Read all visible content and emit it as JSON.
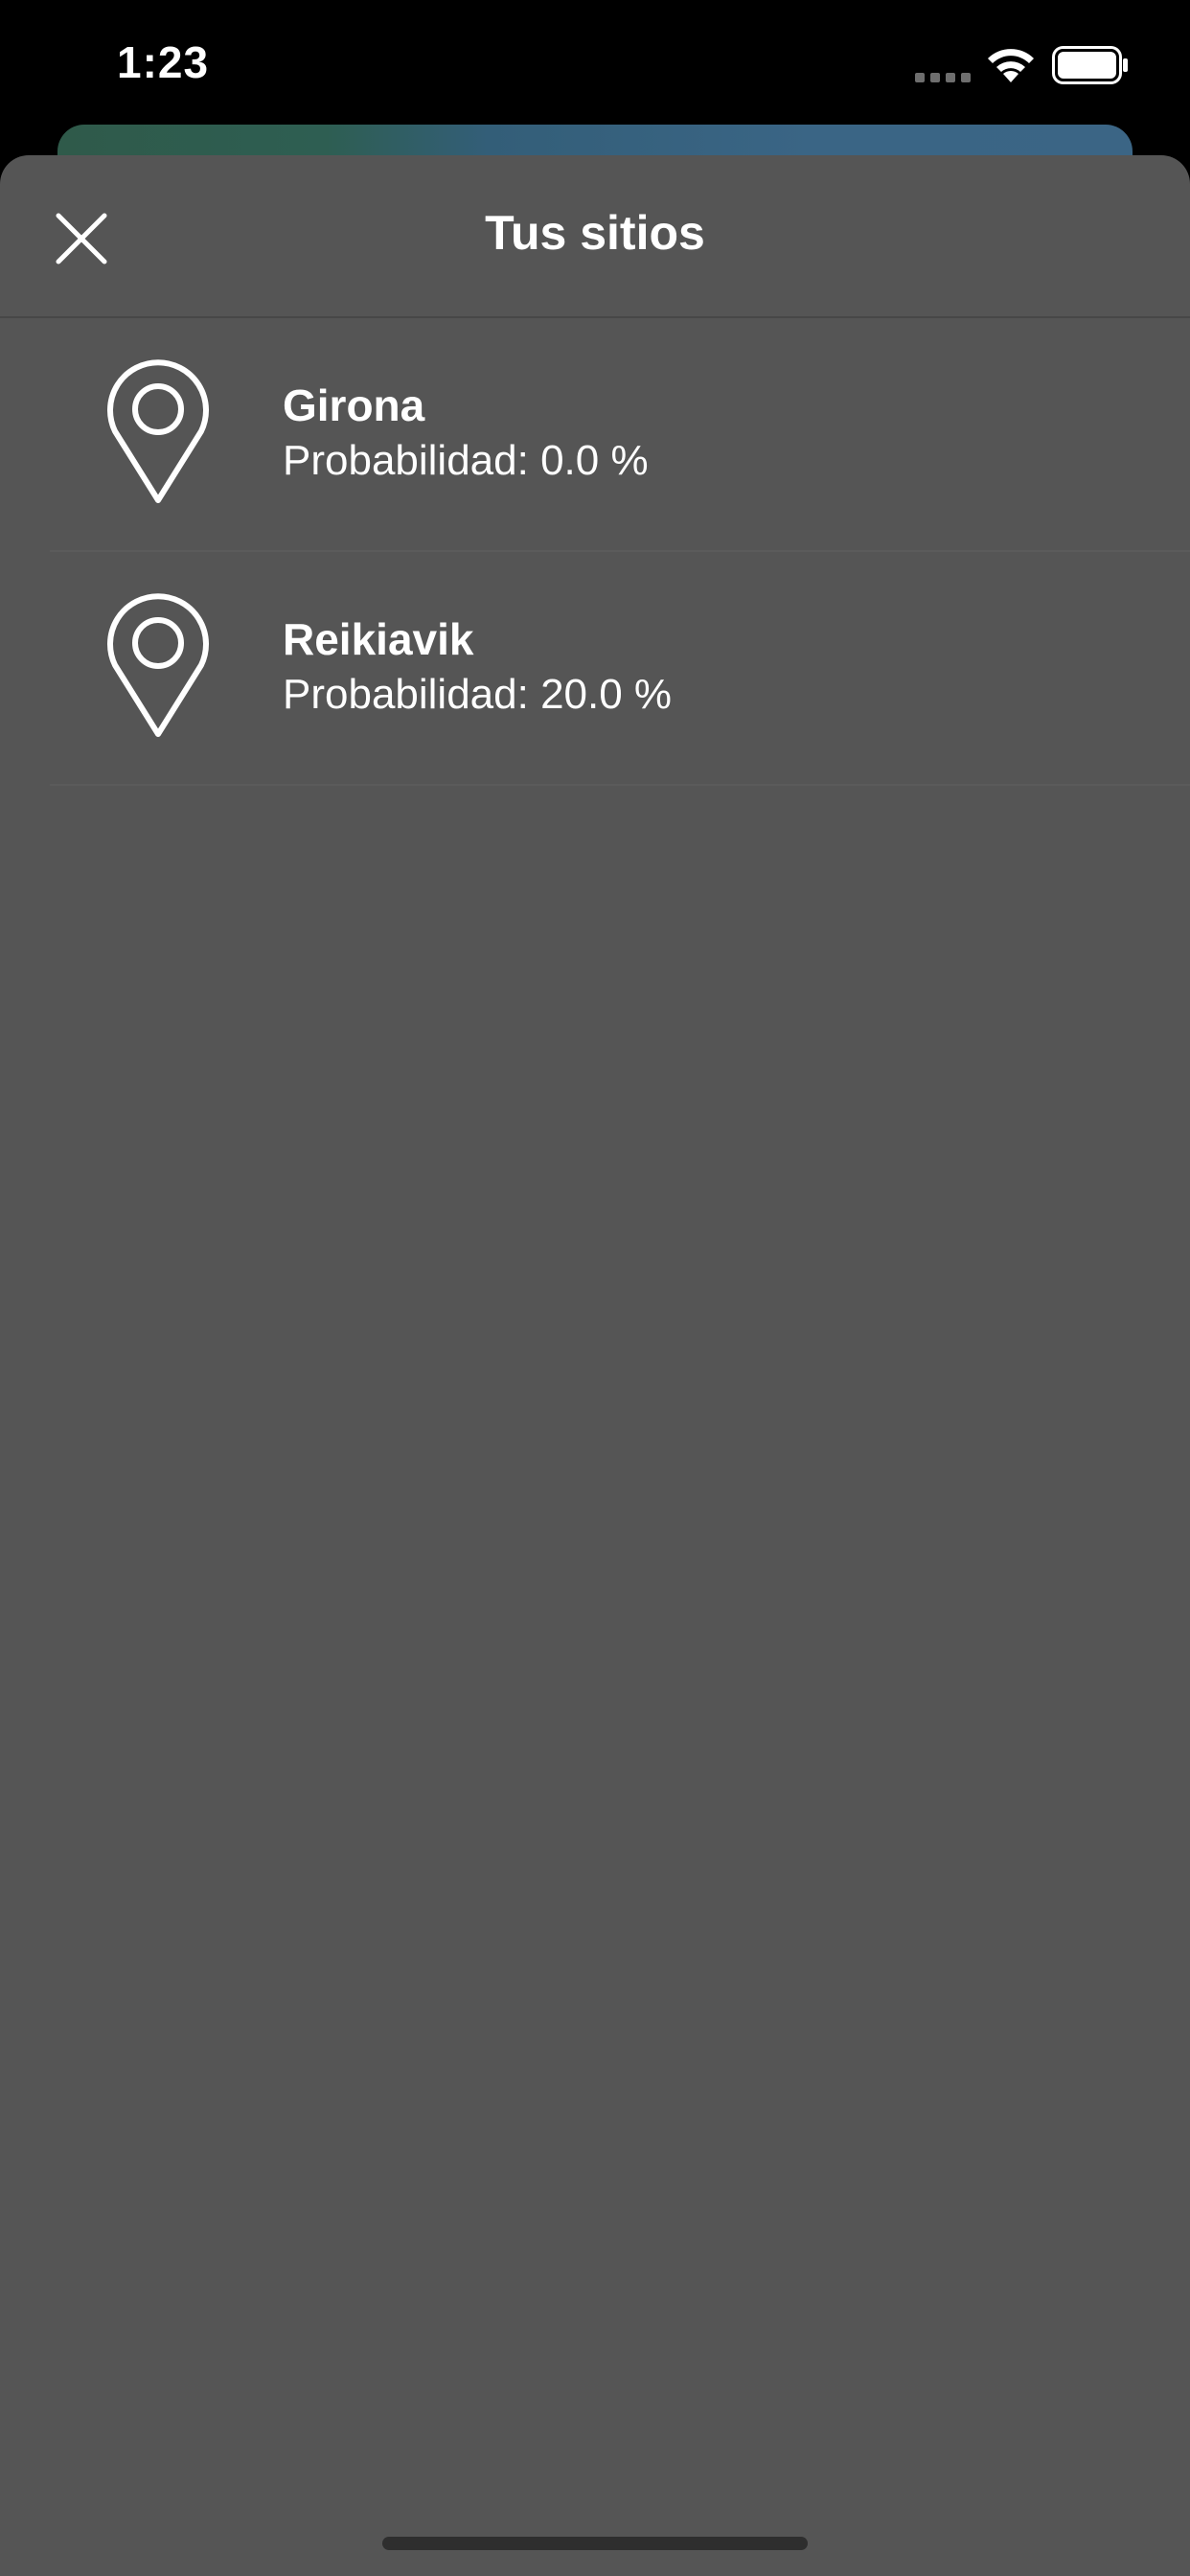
{
  "status_bar": {
    "time": "1:23"
  },
  "sheet": {
    "title": "Tus sitios",
    "close_icon": "close-icon"
  },
  "places": [
    {
      "name": "Girona",
      "probability_text": "Probabilidad: 0.0 %",
      "icon": "map-pin-icon"
    },
    {
      "name": "Reikiavik",
      "probability_text": "Probabilidad: 20.0 %",
      "icon": "map-pin-icon"
    }
  ],
  "colors": {
    "sheet_background": "#555555",
    "text": "#ffffff",
    "status_bar_background": "#000000"
  }
}
